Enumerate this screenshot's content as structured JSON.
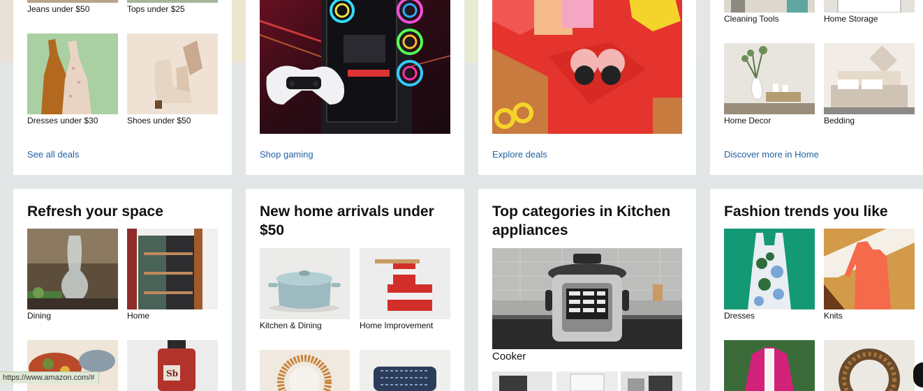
{
  "row1": {
    "cards": [
      {
        "tiles": [
          {
            "label": "Jeans under $50"
          },
          {
            "label": "Tops under $25"
          },
          {
            "label": "Dresses under $30"
          },
          {
            "label": "Shoes under $50"
          }
        ],
        "link": "See all deals"
      },
      {
        "link": "Shop gaming"
      },
      {
        "link": "Explore deals"
      },
      {
        "tiles": [
          {
            "label": "Cleaning Tools"
          },
          {
            "label": "Home Storage"
          },
          {
            "label": "Home Decor"
          },
          {
            "label": "Bedding"
          }
        ],
        "link": "Discover more in Home"
      }
    ]
  },
  "row2": {
    "cards": [
      {
        "title": "Refresh your space",
        "tiles": [
          {
            "label": "Dining"
          },
          {
            "label": "Home"
          }
        ]
      },
      {
        "title": "New home arrivals under $50",
        "tiles": [
          {
            "label": "Kitchen & Dining"
          },
          {
            "label": "Home Improvement"
          }
        ]
      },
      {
        "title": "Top categories in Kitchen appliances",
        "main_label": "Cooker"
      },
      {
        "title": "Fashion trends you like",
        "tiles": [
          {
            "label": "Dresses"
          },
          {
            "label": "Knits"
          }
        ]
      }
    ]
  },
  "status_bar": {
    "url": "https://www.amazon.com/#"
  },
  "colors": {
    "page_bg": "#e3e6e6",
    "link": "#2162a1",
    "text": "#0f1111"
  }
}
